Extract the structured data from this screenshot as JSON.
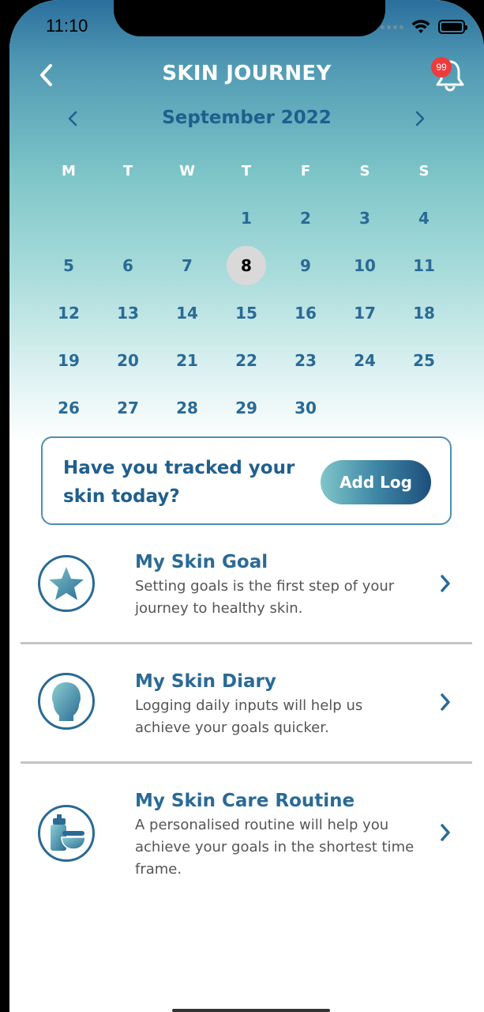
{
  "status_bar": {
    "time": "11:10"
  },
  "header": {
    "title": "SKIN JOURNEY",
    "notification_count": "99",
    "icons": {
      "back": "chevron-left-icon",
      "notifications": "bell-icon"
    }
  },
  "calendar": {
    "month_label": "September 2022",
    "weekdays": [
      "M",
      "T",
      "W",
      "T",
      "F",
      "S",
      "S"
    ],
    "weeks": [
      [
        "",
        "",
        "",
        "1",
        "2",
        "3",
        "4"
      ],
      [
        "5",
        "6",
        "7",
        "8",
        "9",
        "10",
        "11"
      ],
      [
        "12",
        "13",
        "14",
        "15",
        "16",
        "17",
        "18"
      ],
      [
        "19",
        "20",
        "21",
        "22",
        "23",
        "24",
        "25"
      ],
      [
        "26",
        "27",
        "28",
        "29",
        "30",
        "",
        ""
      ]
    ],
    "selected_day": "8"
  },
  "track_card": {
    "question": "Have you tracked your skin today?",
    "button_label": "Add Log"
  },
  "items": [
    {
      "title": "My Skin Goal",
      "description": "Setting goals is the first step of your journey to healthy skin.",
      "icon": "star-icon"
    },
    {
      "title": "My Skin Diary",
      "description": "Logging daily inputs will help us achieve your goals quicker.",
      "icon": "head-icon"
    },
    {
      "title": "My Skin Care Routine",
      "description": "A personalised routine will help you achieve your goals in the shortest time frame.",
      "icon": "skincare-products-icon"
    }
  ],
  "colors": {
    "primary": "#2a6a96",
    "title_dark": "#1f5f8e",
    "badge": "#ef3b3b",
    "selected_day_bg": "#d9d9d9"
  }
}
